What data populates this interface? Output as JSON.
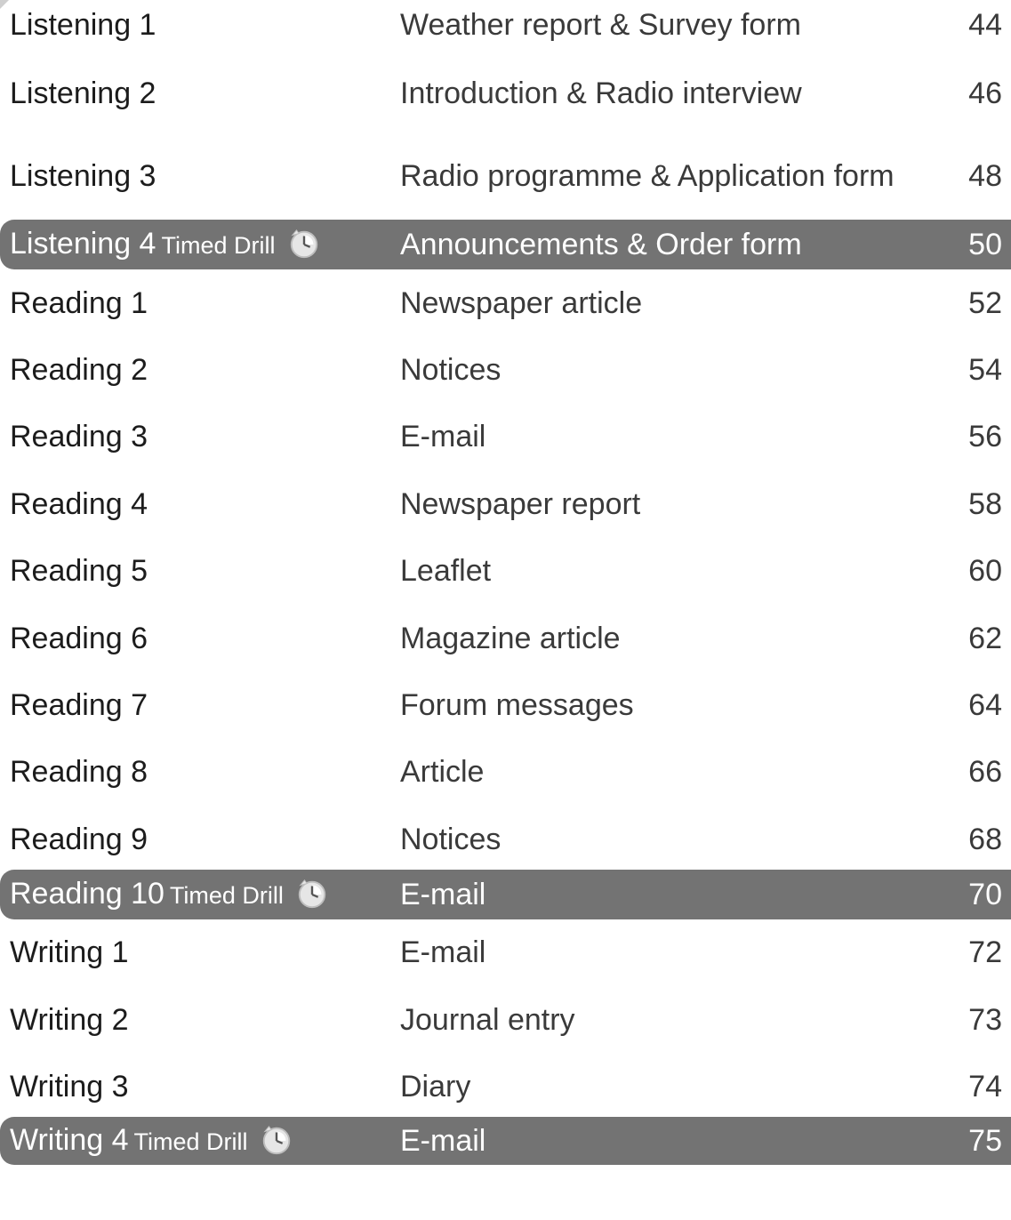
{
  "rows": [
    {
      "title": "Listening 1",
      "topic": "Weather report & Survey form",
      "page": "44"
    },
    {
      "title": "Listening 2",
      "topic": "Introduction & Radio interview",
      "page": "46"
    },
    {
      "title": "Listening 3",
      "topic": "Radio programme & Application form",
      "page": "48"
    },
    {
      "title": "Listening 4",
      "tag": "Timed Drill",
      "icon": "clock-icon",
      "topic": "Announcements & Order form",
      "page": "50"
    },
    {
      "title": "Reading 1",
      "topic": "Newspaper article",
      "page": "52"
    },
    {
      "title": "Reading 2",
      "topic": "Notices",
      "page": "54"
    },
    {
      "title": "Reading 3",
      "topic": "E-mail",
      "page": "56"
    },
    {
      "title": "Reading 4",
      "topic": "Newspaper report",
      "page": "58"
    },
    {
      "title": "Reading 5",
      "topic": "Leaflet",
      "page": "60"
    },
    {
      "title": "Reading 6",
      "topic": "Magazine article",
      "page": "62"
    },
    {
      "title": "Reading 7",
      "topic": "Forum messages",
      "page": "64"
    },
    {
      "title": "Reading 8",
      "topic": "Article",
      "page": "66"
    },
    {
      "title": "Reading 9",
      "topic": "Notices",
      "page": "68"
    },
    {
      "title": "Reading 10",
      "tag": "Timed Drill",
      "icon": "clock-icon",
      "topic": "E-mail",
      "page": "70"
    },
    {
      "title": "Writing 1",
      "topic": "E-mail",
      "page": "72"
    },
    {
      "title": "Writing 2",
      "topic": "Journal entry",
      "page": "73"
    },
    {
      "title": "Writing 3",
      "topic": "Diary",
      "page": "74"
    },
    {
      "title": "Writing 4",
      "tag": "Timed Drill",
      "icon": "clock-icon",
      "topic": "E-mail",
      "page": "75"
    }
  ],
  "colors": {
    "drill_band": "#737373",
    "text": "#1c1c1c",
    "secondary_text": "#3a3a3a"
  }
}
